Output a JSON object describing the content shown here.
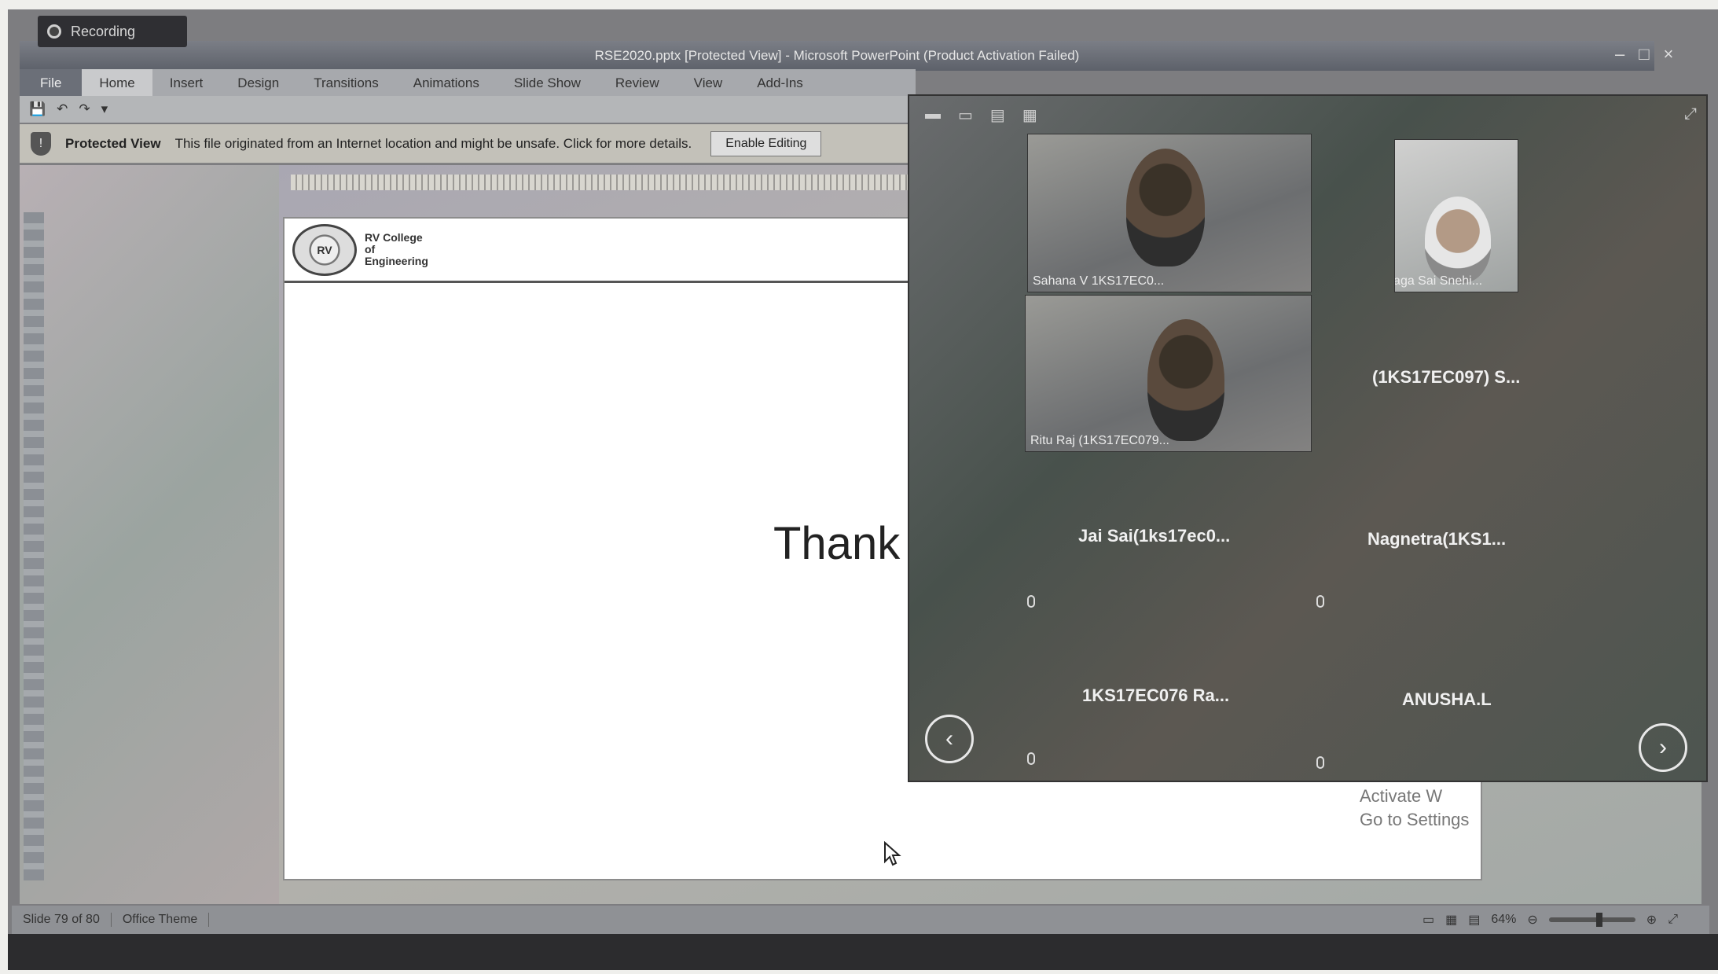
{
  "recording": {
    "label": "Recording"
  },
  "window": {
    "title": "RSE2020.pptx [Protected View] - Microsoft PowerPoint (Product Activation Failed)",
    "controls": [
      "–",
      "□",
      "×"
    ]
  },
  "ribbon": {
    "tabs": [
      {
        "label": "File"
      },
      {
        "label": "Home"
      },
      {
        "label": "Insert"
      },
      {
        "label": "Design"
      },
      {
        "label": "Transitions"
      },
      {
        "label": "Animations"
      },
      {
        "label": "Slide Show"
      },
      {
        "label": "Review"
      },
      {
        "label": "View"
      },
      {
        "label": "Add-Ins"
      }
    ]
  },
  "quick_access": {
    "items": [
      "save",
      "undo",
      "redo",
      "customize"
    ]
  },
  "protected_view": {
    "title": "Protected View",
    "message": "This file originated from an Internet location and might be unsafe. Click for more details.",
    "button": "Enable Editing"
  },
  "slide": {
    "college_logo_text": "RV",
    "college_name": "RV College of Engineering",
    "body_text": "Thank"
  },
  "watermark": {
    "line1": "Activate W",
    "line2": "Go to Settings"
  },
  "status": {
    "slide_position": "Slide 79 of 80",
    "theme": "Office Theme",
    "zoom": "64%"
  },
  "meeting": {
    "video_tiles": [
      {
        "caption": "Sahana V 1KS17EC0..."
      },
      {
        "caption": "Penmatsa Naga Sai Snehi..."
      },
      {
        "caption": "Ritu Raj (1KS17EC079..."
      }
    ],
    "name_tiles": [
      {
        "name": "(1KS17EC097) S..."
      },
      {
        "name": "Jai Sai(1ks17ec0..."
      },
      {
        "name": "Nagnetra(1KS1..."
      },
      {
        "name": "1KS17EC076 Ra..."
      },
      {
        "name": "ANUSHA.L"
      }
    ],
    "prev": "‹",
    "next": "›"
  }
}
